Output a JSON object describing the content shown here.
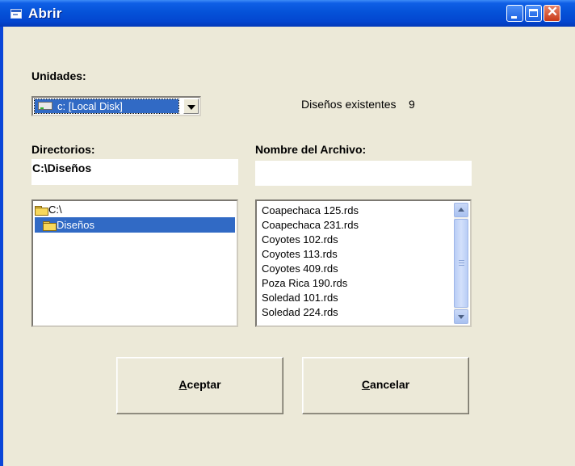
{
  "window": {
    "title": "Abrir"
  },
  "drive": {
    "label": "Unidades:",
    "selected": "c: [Local Disk]"
  },
  "designs": {
    "label": "Diseños existentes",
    "count": "9"
  },
  "directories": {
    "label": "Directorios:",
    "path": "C:\\Diseños",
    "items": [
      {
        "name": "C:\\",
        "selected": false
      },
      {
        "name": "Diseños",
        "selected": true
      }
    ]
  },
  "filename": {
    "label": "Nombre del Archivo:",
    "value": ""
  },
  "files": [
    "Coapechaca 125.rds",
    "Coapechaca 231.rds",
    "Coyotes 102.rds",
    "Coyotes 113.rds",
    "Coyotes 409.rds",
    "Poza Rica 190.rds",
    "Soledad 101.rds",
    "Soledad 224.rds"
  ],
  "buttons": {
    "accept": {
      "hotkey": "A",
      "rest": "ceptar"
    },
    "cancel": {
      "hotkey": "C",
      "rest": "ancelar"
    }
  },
  "colors": {
    "titlebar": "#0552d8",
    "face": "#ece9d8",
    "selection": "#316ac5"
  }
}
